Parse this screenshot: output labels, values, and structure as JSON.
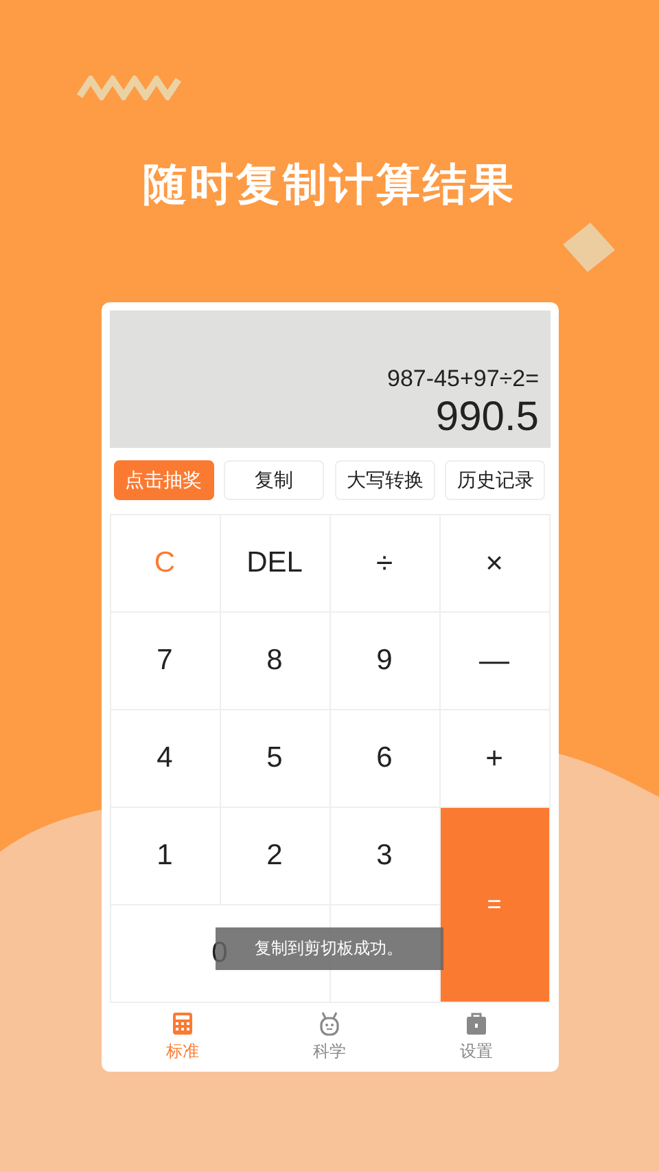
{
  "headline": "随时复制计算结果",
  "display": {
    "expression": "987-45+97÷2=",
    "result": "990.5"
  },
  "actions": [
    {
      "label": "点击抽奖",
      "highlighted": true
    },
    {
      "label": "复制",
      "highlighted": false
    },
    {
      "label": "大写转换",
      "highlighted": false
    },
    {
      "label": "历史记录",
      "highlighted": false
    }
  ],
  "keys": [
    {
      "label": "C",
      "kind": "clear"
    },
    {
      "label": "DEL",
      "kind": "digit"
    },
    {
      "label": "÷",
      "kind": "op"
    },
    {
      "label": "×",
      "kind": "op"
    },
    {
      "label": "7",
      "kind": "digit"
    },
    {
      "label": "8",
      "kind": "digit"
    },
    {
      "label": "9",
      "kind": "digit"
    },
    {
      "label": "—",
      "kind": "op"
    },
    {
      "label": "4",
      "kind": "digit"
    },
    {
      "label": "5",
      "kind": "digit"
    },
    {
      "label": "6",
      "kind": "digit"
    },
    {
      "label": "+",
      "kind": "op"
    },
    {
      "label": "1",
      "kind": "digit"
    },
    {
      "label": "2",
      "kind": "digit"
    },
    {
      "label": "3",
      "kind": "digit"
    },
    {
      "label": "=",
      "kind": "equals"
    },
    {
      "label": "0",
      "kind": "zero"
    }
  ],
  "toast": "复制到剪切板成功。",
  "tabs": [
    {
      "label": "标准",
      "selected": true
    },
    {
      "label": "科学",
      "selected": false
    },
    {
      "label": "设置",
      "selected": false
    }
  ]
}
